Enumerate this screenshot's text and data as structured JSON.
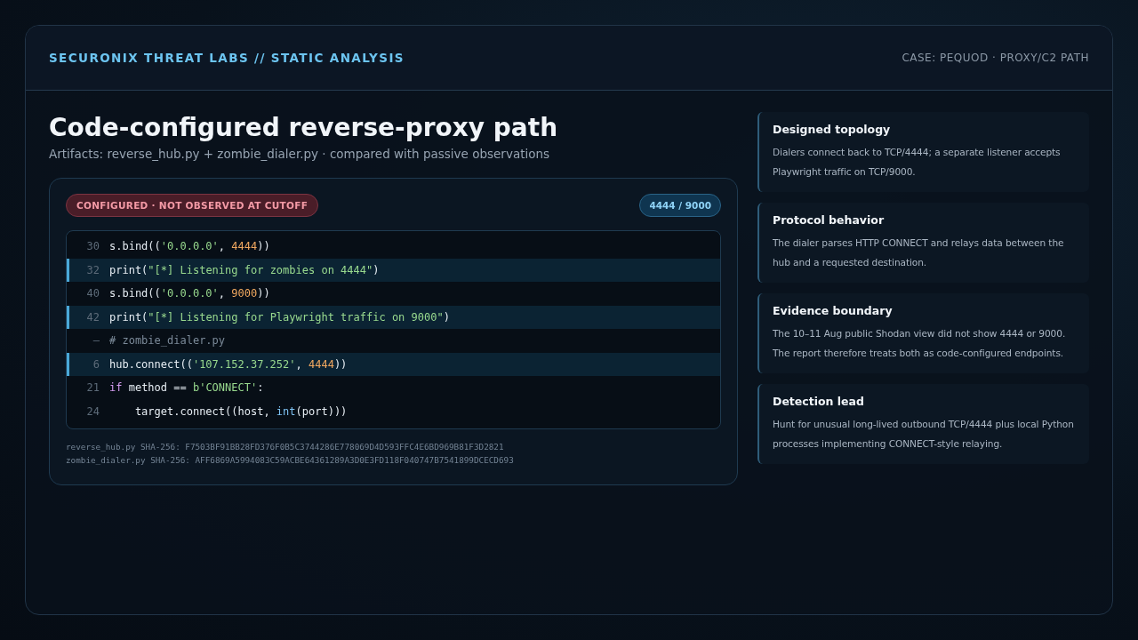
{
  "header": {
    "brand": "SECURONIX THREAT LABS // STATIC ANALYSIS",
    "case": "CASE: PEQUOD · PROXY/C2 PATH"
  },
  "title": "Code-configured reverse-proxy path",
  "subtitle": "Artifacts: reverse_hub.py + zombie_dialer.py · compared with passive observations",
  "code_panel": {
    "status_badge": "CONFIGURED · NOT OBSERVED AT CUTOFF",
    "ports_badge": "4444 / 9000",
    "lines": [
      {
        "num": "30",
        "highlighted": false,
        "tokens": [
          {
            "text": "s.bind((",
            "kind": "plain"
          },
          {
            "text": "'0.0.0.0'",
            "kind": "string"
          },
          {
            "text": ", ",
            "kind": "plain"
          },
          {
            "text": "4444",
            "kind": "number"
          },
          {
            "text": "))",
            "kind": "plain"
          }
        ]
      },
      {
        "num": "32",
        "highlighted": true,
        "tokens": [
          {
            "text": "print(",
            "kind": "plain"
          },
          {
            "text": "\"[*] Listening for zombies on 4444\"",
            "kind": "string"
          },
          {
            "text": ")",
            "kind": "plain"
          }
        ]
      },
      {
        "num": "40",
        "highlighted": false,
        "tokens": [
          {
            "text": "s.bind((",
            "kind": "plain"
          },
          {
            "text": "'0.0.0.0'",
            "kind": "string"
          },
          {
            "text": ", ",
            "kind": "plain"
          },
          {
            "text": "9000",
            "kind": "number"
          },
          {
            "text": "))",
            "kind": "plain"
          }
        ]
      },
      {
        "num": "42",
        "highlighted": true,
        "tokens": [
          {
            "text": "print(",
            "kind": "plain"
          },
          {
            "text": "\"[*] Listening for Playwright traffic on 9000\"",
            "kind": "string"
          },
          {
            "text": ")",
            "kind": "plain"
          }
        ]
      },
      {
        "num": "—",
        "highlighted": false,
        "tokens": [
          {
            "text": "# zombie_dialer.py",
            "kind": "comment"
          }
        ]
      },
      {
        "num": "6",
        "highlighted": true,
        "tokens": [
          {
            "text": "hub.connect((",
            "kind": "plain"
          },
          {
            "text": "'107.152.37.252'",
            "kind": "string"
          },
          {
            "text": ", ",
            "kind": "plain"
          },
          {
            "text": "4444",
            "kind": "number"
          },
          {
            "text": "))",
            "kind": "plain"
          }
        ]
      },
      {
        "num": "21",
        "highlighted": false,
        "tokens": [
          {
            "text": "if",
            "kind": "keyword"
          },
          {
            "text": " method == ",
            "kind": "plain"
          },
          {
            "text": "b'CONNECT'",
            "kind": "string"
          },
          {
            "text": ":",
            "kind": "plain"
          }
        ]
      },
      {
        "num": "24",
        "highlighted": false,
        "tokens": [
          {
            "text": "    target.connect((host, ",
            "kind": "plain"
          },
          {
            "text": "int",
            "kind": "builtin"
          },
          {
            "text": "(port)))",
            "kind": "plain"
          }
        ]
      }
    ],
    "hashes": [
      "reverse_hub.py SHA-256: F7503BF91BB28FD376F0B5C3744286E778069D4D593FFC4E6BD969B81F3D2821",
      "zombie_dialer.py SHA-256: AFF6869A5994083C59ACBE64361289A3D0E3FD118F040747B7541899DCECD693"
    ]
  },
  "cards": [
    {
      "title": "Designed topology",
      "text": "Dialers connect back to TCP/4444; a separate listener accepts Playwright traffic on TCP/9000."
    },
    {
      "title": "Protocol behavior",
      "text": "The dialer parses HTTP CONNECT and relays data between the hub and a requested destination."
    },
    {
      "title": "Evidence boundary",
      "text": "The 10–11 Aug public Shodan view did not show 4444 or 9000. The report therefore treats both as code-configured endpoints."
    },
    {
      "title": "Detection lead",
      "text": "Hunt for unusual long-lived outbound TCP/4444 plus local Python processes implementing CONNECT-style relaying."
    }
  ]
}
